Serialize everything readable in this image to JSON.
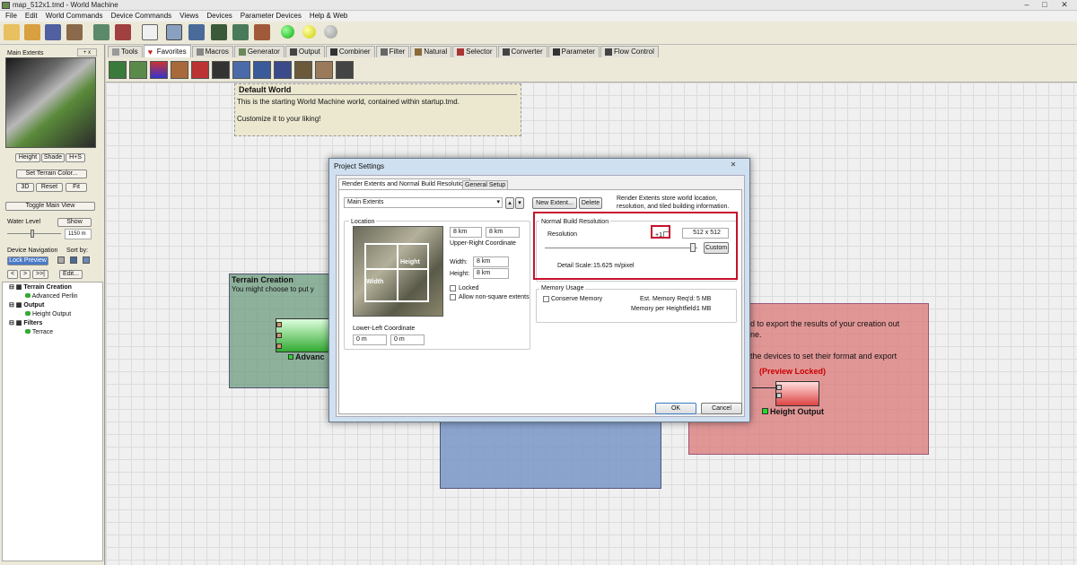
{
  "window": {
    "title": "map_512x1.tmd - World Machine"
  },
  "menu": [
    "File",
    "Edit",
    "World Commands",
    "Device Commands",
    "Views",
    "Devices",
    "Parameter Devices",
    "Help & Web"
  ],
  "left": {
    "panel_title": "Main Extents",
    "pm": "+ x",
    "b_height": "Height",
    "b_shade": "Shade",
    "b_hs": "H+S",
    "b_color": "Set Terrain Color...",
    "b_3d": "3D",
    "b_reset": "Reset",
    "b_fit": "Fit",
    "b_toggle": "Toggle Main View",
    "water_label": "Water Level",
    "b_show": "Show",
    "water_value": "1150 m",
    "nav_label": "Device Navigation",
    "sort_label": "Sort by:",
    "b_lock": "Lock Preview",
    "nav_prev": "<",
    "nav_next": ">",
    "nav_last": ">>|",
    "b_edit": "Edit...",
    "tree": {
      "g1": "Terrain Creation",
      "i1": "Advanced Perlin",
      "g2": "Output",
      "i2": "Height Output",
      "g3": "Filters",
      "i3": "Terrace"
    }
  },
  "tabs": [
    "Tools",
    "Favorites",
    "Macros",
    "Generator",
    "Output",
    "Combiner",
    "Filter",
    "Natural",
    "Selector",
    "Converter",
    "Parameter",
    "Flow Control"
  ],
  "canvas": {
    "dw_title": "Default World",
    "dw_line1": "This is the starting World Machine world, contained within startup.tmd.",
    "dw_line2": "Customize it to your liking!",
    "tc_title": "Terrain Creation",
    "tc_text": "You might choose to put y",
    "tc_node": "Advanc",
    "red_text1": "d to export the results of your creation out",
    "red_text2": "ne.",
    "red_text3": "the devices to set their format and export",
    "red_locked": "(Preview Locked)",
    "red_node": "Height Output"
  },
  "dialog": {
    "title": "Project Settings",
    "tab1": "Render Extents and Normal Build Resolution",
    "tab2": "General Setup",
    "extent": "Main Extents",
    "new_extent": "New Extent...",
    "delete": "Delete",
    "info": "Render Extents store world location, resolution, and tiled building information.",
    "loc_title": "Location",
    "ur1": "8 km",
    "ur2": "8 km",
    "ur_label": "Upper-Right Coordinate",
    "width_label": "Width:",
    "width_value": "8 km",
    "height_label": "Height:",
    "height_value": "8 km",
    "locked": "Locked",
    "nonsquare": "Allow non-square extents",
    "ll_label": "Lower-Left Coordinate",
    "ll1": "0 m",
    "ll2": "0 m",
    "map_width": "Width",
    "map_height": "Height",
    "nbr_title": "Normal Build Resolution",
    "res_label": "Resolution",
    "plus1": "+1",
    "res_value": "512 x 512",
    "custom": "Custom",
    "detail": "Detail Scale:",
    "detail_value": "15.625 m/pixel",
    "mem_title": "Memory Usage",
    "conserve": "Conserve Memory",
    "est_label": "Est. Memory Req'd:",
    "est_value": "5 MB",
    "mph_label": "Memory per Heightfield:",
    "mph_value": "1 MB",
    "ok": "OK",
    "cancel": "Cancel"
  },
  "colors": {
    "highlight": "#c8102e",
    "accent": "#0a6ad8"
  }
}
